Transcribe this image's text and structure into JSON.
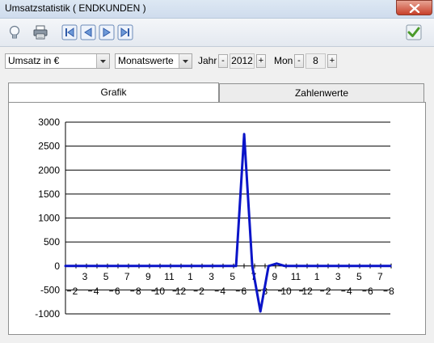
{
  "window": {
    "title": "Umsatzstatistik ( ENDKUNDEN )"
  },
  "toolbar": {
    "buttons": [
      "lightbulb-icon",
      "printer-icon",
      "first-record-icon",
      "previous-record-icon",
      "next-record-icon",
      "last-record-icon",
      "confirm-check-icon"
    ]
  },
  "filters": {
    "metric": "Umsatz in €",
    "period": "Monatswerte",
    "year_label": "Jahr",
    "year_minus": "-",
    "year": "2012",
    "year_plus": "+",
    "month_label": "Mon",
    "month_minus": "-",
    "month": "8",
    "month_plus": "+"
  },
  "tabs": [
    {
      "label": "Grafik",
      "active": true
    },
    {
      "label": "Zahlenwerte",
      "active": false
    }
  ],
  "colors": {
    "line": "#0a14c8",
    "grid": "#000000"
  },
  "chart_data": {
    "type": "line",
    "ylim": [
      -1000,
      3000
    ],
    "yticks": [
      3000,
      2500,
      2000,
      1500,
      1000,
      500,
      0,
      -500,
      -1000
    ],
    "x_labels_upper": [
      "3",
      "5",
      "7",
      "9",
      "11",
      "1",
      "3",
      "5",
      "7",
      "9",
      "11",
      "1",
      "3",
      "5",
      "7"
    ],
    "x_labels_lower": [
      "2",
      "4",
      "6",
      "8",
      "10",
      "12",
      "2",
      "4",
      "6",
      "8",
      "10",
      "12",
      "2",
      "4",
      "6",
      "8"
    ],
    "grid": true,
    "series": [
      {
        "values": [
          0,
          0,
          0,
          0,
          0,
          0,
          0,
          0,
          0,
          0,
          0,
          0,
          0,
          0,
          0,
          0,
          0,
          0,
          0,
          0,
          0,
          0,
          2750,
          0,
          -950,
          0,
          50,
          0,
          0,
          0,
          0,
          0,
          0,
          0,
          0,
          0,
          0,
          0,
          0,
          0,
          0
        ]
      }
    ]
  }
}
